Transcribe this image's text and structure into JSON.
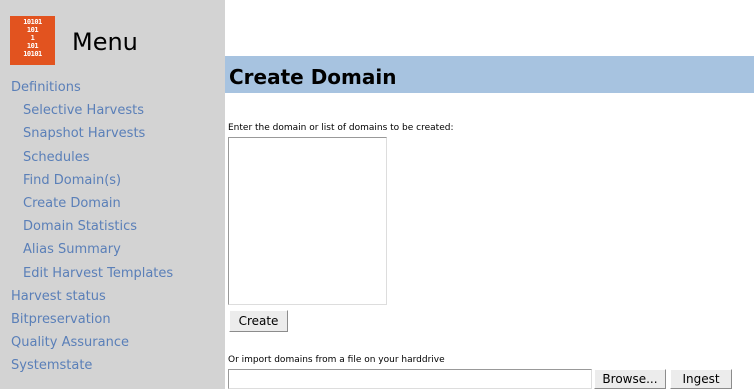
{
  "sidebar": {
    "logo_lines": [
      "10101",
      "101",
      "1",
      "101",
      "10101"
    ],
    "menu_title": "Menu",
    "items": [
      {
        "label": "Definitions",
        "level": "top"
      },
      {
        "label": "Selective Harvests",
        "level": "sub"
      },
      {
        "label": "Snapshot Harvests",
        "level": "sub"
      },
      {
        "label": "Schedules",
        "level": "sub"
      },
      {
        "label": "Find Domain(s)",
        "level": "sub"
      },
      {
        "label": "Create Domain",
        "level": "sub"
      },
      {
        "label": "Domain Statistics",
        "level": "sub"
      },
      {
        "label": "Alias Summary",
        "level": "sub"
      },
      {
        "label": "Edit Harvest Templates",
        "level": "sub"
      },
      {
        "label": "Harvest status",
        "level": "top"
      },
      {
        "label": "Bitpreservation",
        "level": "top"
      },
      {
        "label": "Quality Assurance",
        "level": "top"
      },
      {
        "label": "Systemstate",
        "level": "top"
      }
    ]
  },
  "main": {
    "title": "Create Domain",
    "instruction": "Enter the domain or list of domains to be created:",
    "domains_value": "",
    "create_label": "Create",
    "import_label": "Or import domains from a file on your harddrive",
    "browse_label": "Browse...",
    "ingest_label": "Ingest"
  },
  "colors": {
    "sidebar_bg": "#d3d3d3",
    "link": "#5a7fb8",
    "title_bar": "#a7c3e0",
    "logo": "#e2531f"
  }
}
